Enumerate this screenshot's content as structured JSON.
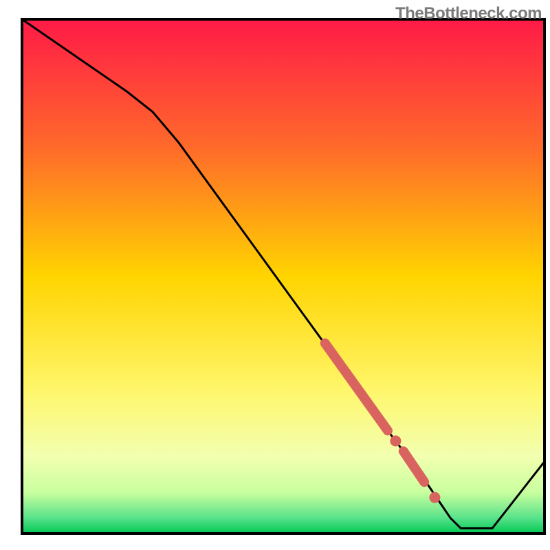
{
  "attribution": "TheBottleneck.com",
  "chart_data": {
    "type": "line",
    "title": "",
    "xlabel": "",
    "ylabel": "",
    "xlim": [
      0,
      100
    ],
    "ylim": [
      0,
      100
    ],
    "grid": false,
    "legend": false,
    "gradient_stops": [
      {
        "offset": 0.0,
        "color": "#ff1a47"
      },
      {
        "offset": 0.25,
        "color": "#ff6a2a"
      },
      {
        "offset": 0.5,
        "color": "#ffd400"
      },
      {
        "offset": 0.72,
        "color": "#fff66a"
      },
      {
        "offset": 0.85,
        "color": "#f2ffb0"
      },
      {
        "offset": 0.92,
        "color": "#c9ff9e"
      },
      {
        "offset": 0.97,
        "color": "#58e28a"
      },
      {
        "offset": 1.0,
        "color": "#00c853"
      }
    ],
    "series": [
      {
        "name": "bottleneck-curve",
        "color": "#000000",
        "style": "line",
        "x": [
          0,
          10,
          20,
          25,
          30,
          40,
          50,
          60,
          65,
          70,
          73,
          76,
          80,
          82,
          84,
          90,
          100
        ],
        "y": [
          100,
          93,
          86,
          82,
          76,
          62,
          48,
          34,
          27,
          20,
          16,
          12,
          6,
          3,
          1,
          1,
          14
        ]
      },
      {
        "name": "highlight-segment-1",
        "color": "#d9645f",
        "style": "thick-line",
        "x": [
          58,
          70
        ],
        "y": [
          37,
          20
        ]
      },
      {
        "name": "highlight-point-1",
        "color": "#d9645f",
        "style": "point",
        "x": [
          71.5
        ],
        "y": [
          18
        ]
      },
      {
        "name": "highlight-segment-2",
        "color": "#d9645f",
        "style": "thick-line",
        "x": [
          73,
          77
        ],
        "y": [
          16,
          10
        ]
      },
      {
        "name": "highlight-point-2",
        "color": "#d9645f",
        "style": "point",
        "x": [
          79
        ],
        "y": [
          7
        ]
      }
    ]
  }
}
